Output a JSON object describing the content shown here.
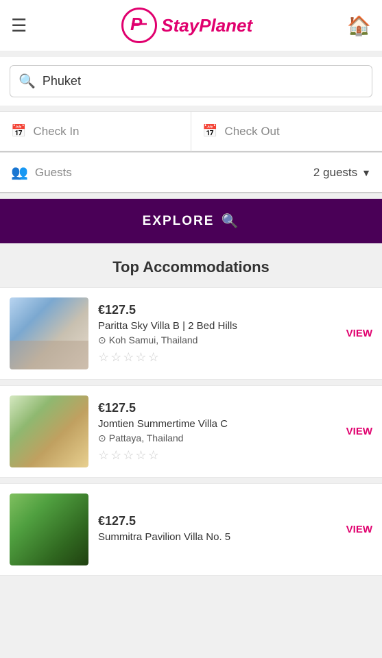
{
  "header": {
    "logo_text": "StayPlanet",
    "logo_letter": "P"
  },
  "search": {
    "placeholder": "Phuket",
    "value": "Phuket"
  },
  "checkin": {
    "label": "Check In"
  },
  "checkout": {
    "label": "Check Out"
  },
  "guests": {
    "label": "Guests",
    "value": "2 guests"
  },
  "explore_button": {
    "label": "EXPLORE"
  },
  "section_title": "Top Accommodations",
  "accommodations": [
    {
      "price": "€127.5",
      "name": "Paritta Sky Villa B | 2 Bed Hills",
      "location": "Koh Samui, Thailand",
      "stars": 0,
      "view_label": "VIEW"
    },
    {
      "price": "€127.5",
      "name": "Jomtien Summertime Villa C",
      "location": "Pattaya, Thailand",
      "stars": 0,
      "view_label": "VIEW"
    },
    {
      "price": "€127.5",
      "name": "Summitra Pavilion Villa No. 5",
      "location": "",
      "stars": 0,
      "view_label": "VIEW"
    }
  ]
}
